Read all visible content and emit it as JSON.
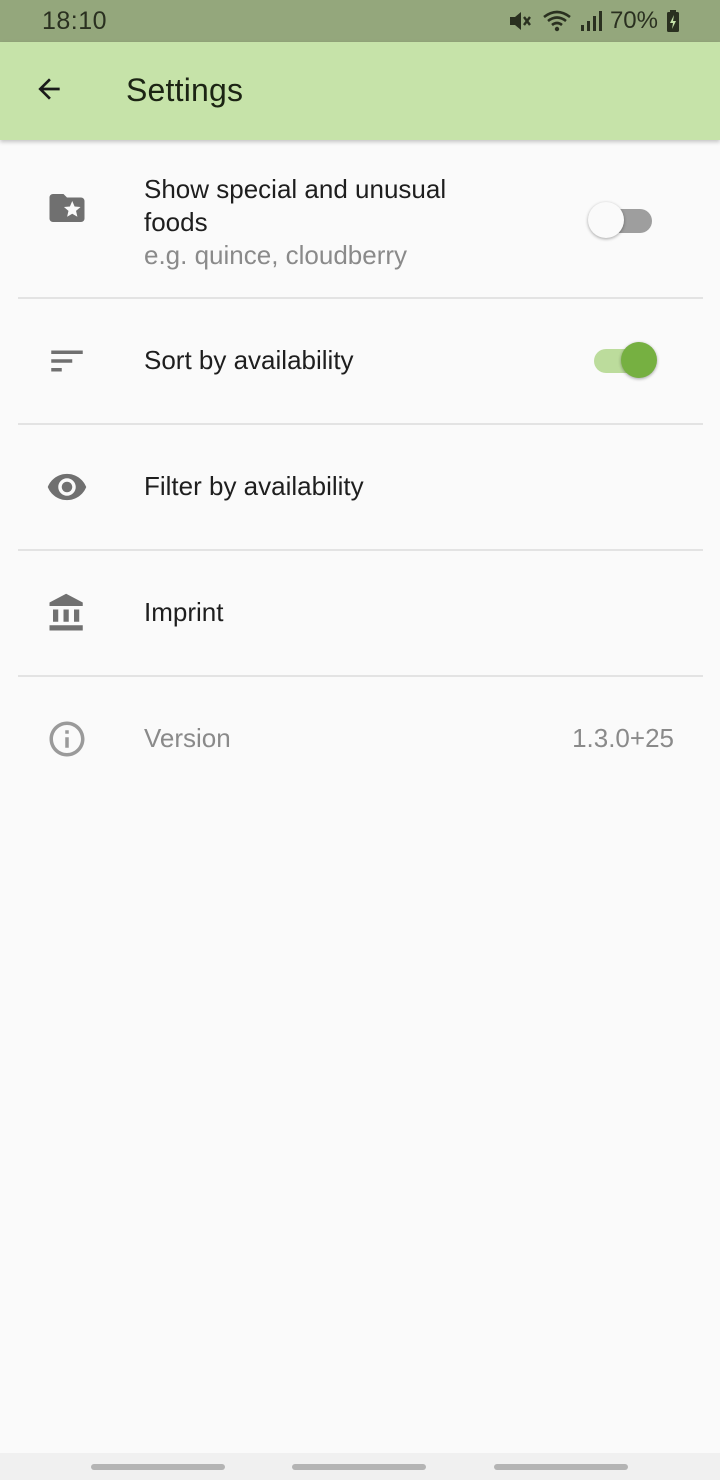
{
  "status_bar": {
    "time": "18:10",
    "battery_percent": "70%",
    "icons": [
      "mute-icon",
      "wifi-icon",
      "signal-icon",
      "battery-charging-icon"
    ]
  },
  "app_bar": {
    "back_icon": "arrow-back-icon",
    "title": "Settings",
    "background": "#c6e3a9"
  },
  "settings": {
    "special_foods": {
      "icon": "folder-star-icon",
      "title": "Show special and unusual foods",
      "subtitle": "e.g. quince, cloudberry",
      "enabled": false
    },
    "sort": {
      "icon": "sort-icon",
      "title": "Sort by availability",
      "enabled": true
    },
    "filter": {
      "icon": "eye-icon",
      "title": "Filter by availability"
    },
    "imprint": {
      "icon": "bank-icon",
      "title": "Imprint"
    },
    "version": {
      "icon": "info-icon",
      "title": "Version",
      "value": "1.3.0+25"
    }
  },
  "colors": {
    "accent": "#76b041",
    "accent_track": "#bcdc9c",
    "switch_off_thumb": "#fafafa",
    "switch_off_track": "#9e9e9e",
    "status_bar": "#94a77c"
  }
}
